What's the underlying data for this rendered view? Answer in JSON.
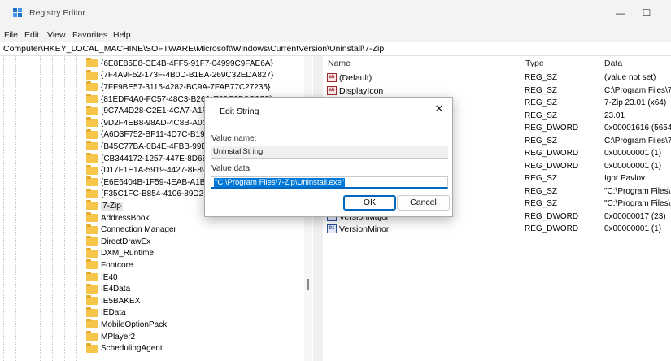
{
  "window": {
    "title": "Registry Editor",
    "minimize_glyph": "—",
    "maximize_glyph": "☐"
  },
  "menu": [
    "File",
    "Edit",
    "View",
    "Favorites",
    "Help"
  ],
  "address": "Computer\\HKEY_LOCAL_MACHINE\\SOFTWARE\\Microsoft\\Windows\\CurrentVersion\\Uninstall\\7-Zip",
  "tree": {
    "items": [
      "{6E8E85E8-CE4B-4FF5-91F7-04999C9FAE6A}",
      "{7F4A9F52-173F-4B0D-B1EA-269C32EDA827}",
      "{7FF9BE57-3115-4282-BC9A-7FAB77C27235}",
      "{81EDF4A0-FC57-48C3-B26A-E00C3D2C6C5}",
      "{9C7A4D28-C2E1-4CA7-A1F3-",
      "{9D2F4EB8-98AD-4C8B-A0C5-",
      "{A6D3F752-BF11-4D7C-B19C-",
      "{B45C77BA-0B4E-4FBB-99B9-",
      "{CB344172-1257-447E-8D6B-",
      "{D17F1E1A-5919-4427-8F89-A",
      "{E6E6404B-1F59-4EAB-A1B9-E",
      "{F35C1FC-B854-4106-89D2-5",
      "7-Zip",
      "AddressBook",
      "Connection Manager",
      "DirectDrawEx",
      "DXM_Runtime",
      "Fontcore",
      "IE40",
      "IE4Data",
      "IE5BAKEX",
      "IEData",
      "MobileOptionPack",
      "MPlayer2",
      "SchedulingAgent"
    ],
    "selected": "7-Zip"
  },
  "list": {
    "headers": {
      "name": "Name",
      "type": "Type",
      "data": "Data"
    },
    "rows": [
      {
        "name": "(Default)",
        "type": "REG_SZ",
        "data": "(value not set)",
        "icon": "string-value-icon"
      },
      {
        "name": "DisplayIcon",
        "type": "REG_SZ",
        "data": "C:\\Program Files\\7-",
        "icon": "string-value-icon"
      },
      {
        "name": "",
        "type": "REG_SZ",
        "data": "7-Zip 23.01 (x64)",
        "icon": ""
      },
      {
        "name": "",
        "type": "REG_SZ",
        "data": "23.01",
        "icon": ""
      },
      {
        "name": "",
        "type": "REG_DWORD",
        "data": "0x00001616 (5654)",
        "icon": ""
      },
      {
        "name": "",
        "type": "REG_SZ",
        "data": "C:\\Program Files\\7-",
        "icon": ""
      },
      {
        "name": "",
        "type": "REG_DWORD",
        "data": "0x00000001 (1)",
        "icon": ""
      },
      {
        "name": "",
        "type": "REG_DWORD",
        "data": "0x00000001 (1)",
        "icon": ""
      },
      {
        "name": "",
        "type": "REG_SZ",
        "data": "Igor Pavlov",
        "icon": ""
      },
      {
        "name": "",
        "type": "REG_SZ",
        "data": "\"C:\\Program Files\\7-",
        "icon": ""
      },
      {
        "name": "",
        "type": "REG_SZ",
        "data": "\"C:\\Program Files\\7-",
        "icon": ""
      },
      {
        "name": "VersionMajor",
        "type": "REG_DWORD",
        "data": "0x00000017 (23)",
        "icon": "binary-value-icon"
      },
      {
        "name": "VersionMinor",
        "type": "REG_DWORD",
        "data": "0x00000001 (1)",
        "icon": "binary-value-icon"
      }
    ]
  },
  "dialog": {
    "title": "Edit String",
    "close_glyph": "✕",
    "value_name_label": "Value name:",
    "value_name": "UninstallString",
    "value_data_label": "Value data:",
    "value_data": "\"C:\\Program Files\\7-Zip\\Uninstall.exe\"",
    "ok_label": "OK",
    "cancel_label": "Cancel"
  },
  "colors": {
    "accent": "#0067c0",
    "selection": "#0078d7",
    "folder": "#f5c64a"
  }
}
